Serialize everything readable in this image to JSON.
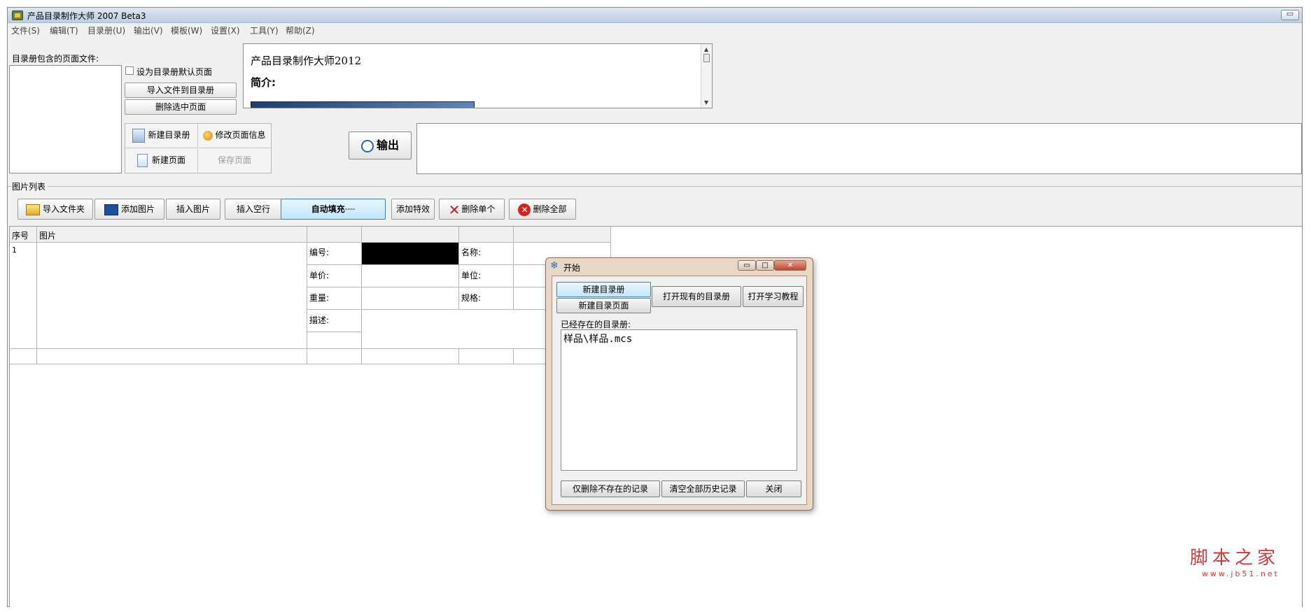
{
  "window": {
    "title": "产品目录制作大师 2007 Beta3",
    "minimize_glyph": "▭"
  },
  "menu": [
    {
      "label": "文件(S)"
    },
    {
      "label": "编辑(T)"
    },
    {
      "label": "目录册(U)"
    },
    {
      "label": "输出(V)"
    },
    {
      "label": "模板(W)"
    },
    {
      "label": "设置(X)"
    },
    {
      "label": "工具(Y)"
    },
    {
      "label": "帮助(Z)"
    }
  ],
  "top": {
    "pages_label": "目录册包含的页面文件:",
    "default_page_checkbox": "设为目录册默认页面",
    "import_to_catalog": "导入文件到目录册",
    "delete_selected_page": "删除选中页面",
    "new_catalog": "新建目录册",
    "edit_page_info": "修改页面信息",
    "new_page": "新建页面",
    "save_page": "保存页面",
    "output": "输出",
    "preview_heading": "产品目录制作大师2012",
    "preview_intro": "简介:"
  },
  "image_list": {
    "section_label": "图片列表",
    "toolbar": {
      "import_folder": "导入文件夹",
      "add_image": "添加图片",
      "insert_image": "插入图片",
      "insert_blank_row": "插入空行",
      "auto_fill": "自动填充┈┈",
      "add_effect": "添加特效",
      "delete_one": "删除单个",
      "delete_all": "删除全部"
    },
    "columns": {
      "index": "序号",
      "image": "图片"
    },
    "rows": [
      {
        "index": "1",
        "code_label": "编号:",
        "name_label": "名称:",
        "price_label": "单价:",
        "unit_label": "单位:",
        "weight_label": "重量:",
        "spec_label": "规格:",
        "desc_label": "描述:"
      }
    ]
  },
  "dialog": {
    "title": "开始",
    "new_catalog": "新建目录册",
    "new_catalog_page": "新建目录页面",
    "open_existing": "打开现有的目录册",
    "open_tutorial": "打开学习教程",
    "existing_label": "已经存在的目录册:",
    "existing_items": [
      "样品\\样品.mcs"
    ],
    "delete_missing": "仅删除不存在的记录",
    "clear_history": "清空全部历史记录",
    "close": "关闭"
  },
  "watermark": {
    "line1": "脚本之家",
    "line2": "www.jb51.net"
  }
}
